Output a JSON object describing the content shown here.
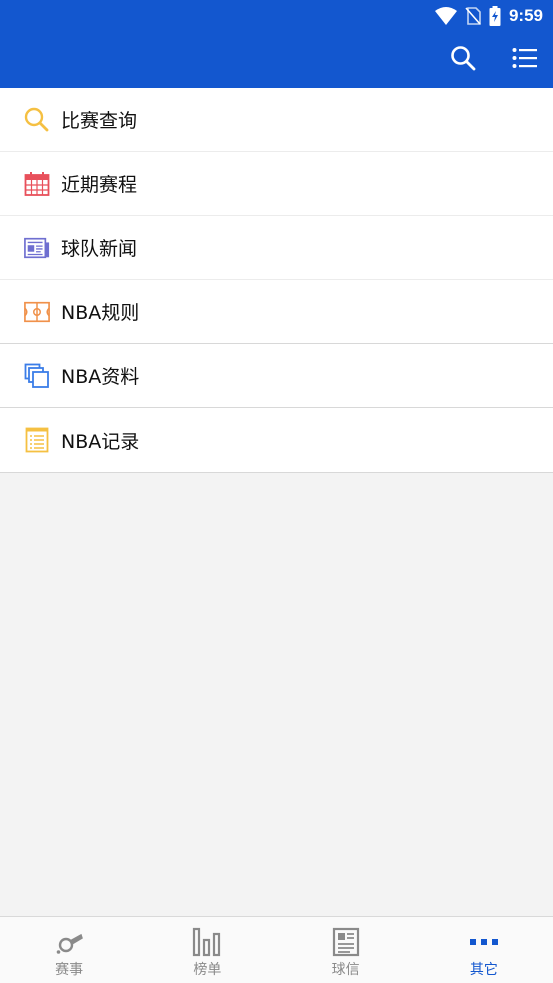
{
  "status_bar": {
    "time": "9:59"
  },
  "app_bar": {
    "search_icon": "search-icon",
    "list_icon": "list-icon"
  },
  "menu": {
    "items": [
      {
        "label": "比赛查询",
        "icon": "search-icon",
        "color": "#f5c042"
      },
      {
        "label": "近期赛程",
        "icon": "calendar-icon",
        "color": "#e8505b"
      },
      {
        "label": "球队新闻",
        "icon": "newspaper-icon",
        "color": "#6f6fd0"
      },
      {
        "label": "NBA规则",
        "icon": "court-icon",
        "color": "#f0914a"
      },
      {
        "label": "NBA资料",
        "icon": "copy-icon",
        "color": "#3b7de8"
      },
      {
        "label": "NBA记录",
        "icon": "notebook-icon",
        "color": "#f5c042"
      }
    ]
  },
  "bottom_nav": {
    "tabs": [
      {
        "label": "赛事",
        "icon": "whistle-icon"
      },
      {
        "label": "榜单",
        "icon": "bar-chart-icon"
      },
      {
        "label": "球信",
        "icon": "news-icon"
      },
      {
        "label": "其它",
        "icon": "more-icon",
        "active": true
      }
    ]
  },
  "colors": {
    "primary": "#1357cf",
    "background": "#f3f3f3",
    "inactive": "#8a8a8a"
  }
}
